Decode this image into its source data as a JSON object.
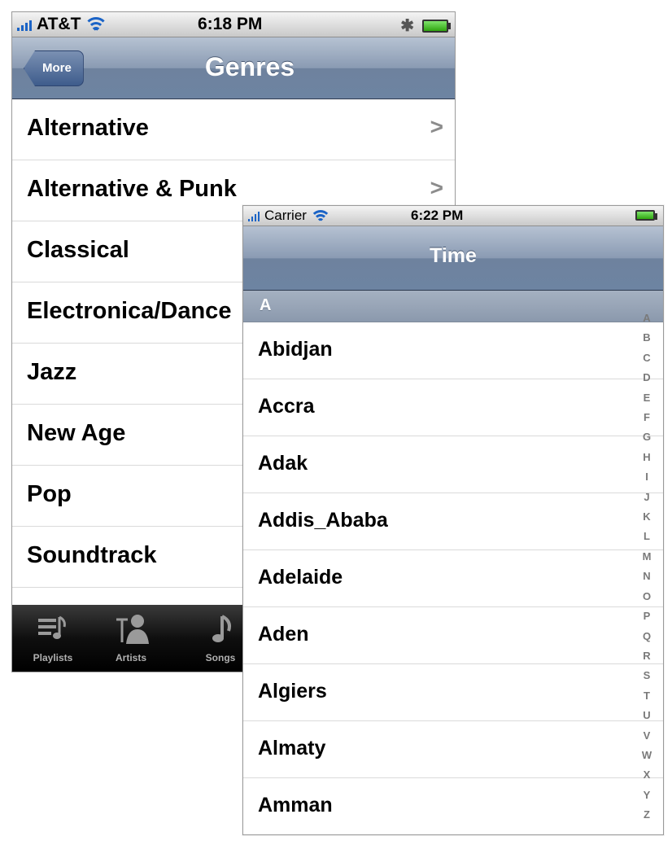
{
  "phone1": {
    "status": {
      "carrier": "AT&T",
      "time": "6:18 PM"
    },
    "nav": {
      "back_label": "More",
      "title": "Genres"
    },
    "rows": [
      "Alternative",
      "Alternative & Punk",
      "Classical",
      "Electronica/Dance",
      "Jazz",
      "New Age",
      "Pop",
      "Soundtrack"
    ],
    "tabs": [
      {
        "label": "Playlists",
        "icon": "playlists-icon"
      },
      {
        "label": "Artists",
        "icon": "artists-icon"
      },
      {
        "label": "Songs",
        "icon": "songs-icon"
      }
    ]
  },
  "phone2": {
    "status": {
      "carrier": "Carrier",
      "time": "6:22 PM"
    },
    "nav": {
      "title": "Time"
    },
    "section": "A",
    "rows": [
      "Abidjan",
      "Accra",
      "Adak",
      "Addis_Ababa",
      "Adelaide",
      "Aden",
      "Algiers",
      "Almaty",
      "Amman"
    ],
    "index": [
      "A",
      "B",
      "C",
      "D",
      "E",
      "F",
      "G",
      "H",
      "I",
      "J",
      "K",
      "L",
      "M",
      "N",
      "O",
      "P",
      "Q",
      "R",
      "S",
      "T",
      "U",
      "V",
      "W",
      "X",
      "Y",
      "Z"
    ]
  },
  "colors": {
    "accent_blue": "#1a63c6",
    "nav_bar": "#6d84a2",
    "battery_green": "#2fa50f"
  }
}
